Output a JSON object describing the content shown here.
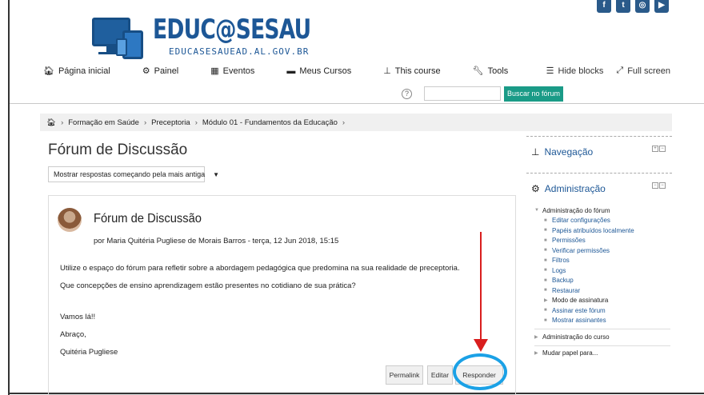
{
  "site": {
    "title": "EDUC@SESAU",
    "url": "EDUCASESAUEAD.AL.GOV.BR"
  },
  "nav": {
    "items": [
      {
        "icon": "home-icon",
        "label": "Página inicial"
      },
      {
        "icon": "dashboard-icon",
        "label": "Painel"
      },
      {
        "icon": "calendar-icon",
        "label": "Eventos"
      },
      {
        "icon": "courses-icon",
        "label": "Meus Cursos"
      },
      {
        "icon": "sitemap-icon",
        "label": "This course"
      },
      {
        "icon": "wrench-icon",
        "label": "Tools"
      }
    ],
    "hide_blocks": "Hide blocks",
    "full_screen": "Full screen"
  },
  "search": {
    "value": "",
    "button": "Buscar no fórum",
    "help": "?"
  },
  "breadcrumb": [
    "Formação em Saúde",
    "Preceptoria",
    "Módulo 01 - Fundamentos da Educação"
  ],
  "page_title": "Fórum de Discussão",
  "sort": {
    "selected": "Mostrar respostas começando pela mais antiga"
  },
  "post": {
    "title": "Fórum de Discussão",
    "meta": "por Maria Quitéria Pugliese de Morais Barros - terça, 12 Jun 2018, 15:15",
    "body": [
      "Utilize o espaço do fórum para refletir sobre a abordagem pedagógica que predomina na sua realidade de preceptoria.",
      "Que concepções de ensino aprendizagem estão presentes no cotidiano de sua prática?"
    ],
    "closing": [
      "Vamos lá!!",
      "Abraço,",
      "Quitéria Pugliese"
    ],
    "buttons": {
      "permalink": "Permalink",
      "edit": "Editar",
      "reply": "Responder"
    }
  },
  "sidebar": {
    "navigation": "Navegação",
    "administration": "Administração",
    "forum_admin": "Administração do fórum",
    "forum_items": [
      "Editar configurações",
      "Papéis atribuídos localmente",
      "Permissões",
      "Verificar permissões",
      "Filtros",
      "Logs",
      "Backup",
      "Restaurar"
    ],
    "signature_mode": "Modo de assinatura",
    "forum_items_2": [
      "Assinar este fórum",
      "Mostrar assinantes"
    ],
    "course_admin": "Administração do curso",
    "change_role": "Mudar papel para..."
  },
  "colors": {
    "brand": "#1d5796",
    "accent": "#1a9b87",
    "arrow": "#d91e1e",
    "circle": "#1ba1e6"
  }
}
